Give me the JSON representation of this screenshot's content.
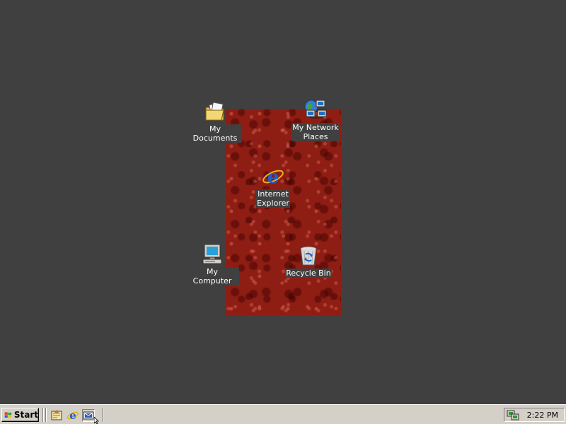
{
  "desktop": {
    "background_color": "#404040",
    "wallpaper_color": "#8e1d14",
    "icons": [
      {
        "label": "My Documents",
        "icon": "my-documents-icon"
      },
      {
        "label": "My Network\nPlaces",
        "icon": "my-network-places-icon"
      },
      {
        "label": "Internet\nExplorer",
        "icon": "internet-explorer-icon"
      },
      {
        "label": "My Computer",
        "icon": "my-computer-icon"
      },
      {
        "label": "Recycle Bin",
        "icon": "recycle-bin-icon"
      }
    ]
  },
  "taskbar": {
    "start_label": "Start",
    "quick_launch": [
      {
        "icon": "show-desktop-icon"
      },
      {
        "icon": "internet-explorer-icon"
      },
      {
        "icon": "outlook-express-icon"
      }
    ],
    "tray": {
      "icons": [
        "network-connection-icon"
      ],
      "clock": "2:22 PM"
    }
  }
}
